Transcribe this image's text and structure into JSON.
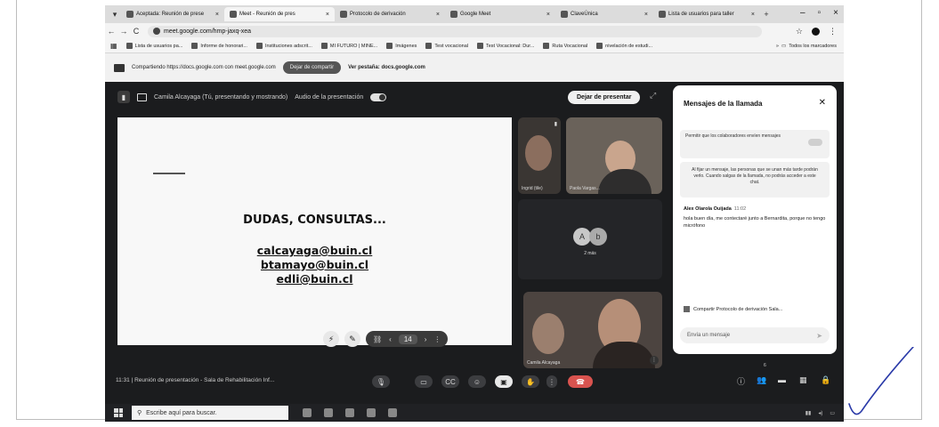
{
  "browser": {
    "tabs": [
      {
        "label": "Aceptada: Reunión de prese",
        "active": false
      },
      {
        "label": "Meet - Reunión de pres",
        "active": true
      },
      {
        "label": "Protocolo de derivación",
        "active": false
      },
      {
        "label": "Google Meet",
        "active": false
      },
      {
        "label": "ClaveÚnica",
        "active": false
      },
      {
        "label": "Lista de usuarios para taller",
        "active": false
      }
    ],
    "url": "meet.google.com/hmp-jaxq-xea",
    "bookmarks": [
      "Lista de usuarios pa...",
      "Informe de honorari...",
      "Instituciones adscrit...",
      "MI FUTURO | MINE...",
      "Imágenes",
      "Test vocacional",
      "Test Vocacional: Dur...",
      "Ruta Vocacional",
      "nivelación de estudi..."
    ],
    "all_bookmarks": "Todos los marcadores"
  },
  "share_bar": {
    "text": "Compartiendo https://docs.google.com con meet.google.com",
    "stop_label": "Dejar de compartir",
    "tab_text": "Ver pestaña: docs.google.com"
  },
  "meet": {
    "presenting_text": "Camila Alcayaga (Tú, presentando y mostrando)",
    "audio_text": "Audio de la presentación",
    "stop_presenting": "Dejar de presentar",
    "slide": {
      "title": "DUDAS, CONSULTAS...",
      "emails": [
        "calcayaga@buin.cl",
        "btamayo@buin.cl",
        "edli@buin.cl"
      ]
    },
    "slide_page": "14",
    "tiles": [
      {
        "name": "Ingrid (tile)"
      },
      {
        "name": "Paola Vargas..."
      },
      {
        "name": "2 más",
        "avatars": [
          "A",
          "b"
        ]
      },
      {
        "name": "Camila Alcayaga"
      }
    ],
    "meeting_info": "11:31  |  Reunión de presentación - Sala de Rehabilitación Inf...",
    "participant_count": "6"
  },
  "chat": {
    "title": "Mensajes de la llamada",
    "permission_text": "Permitir que los colaboradores envíen mensajes",
    "info_text": "Al fijar un mensaje, las personas que se unan más tarde podrán verlo. Cuando salgas de la llamada, no podrás acceder a este chat.",
    "messages": [
      {
        "sender": "Alex Olarola Ouijada",
        "time": "11:02",
        "text": "hola buen día, me contectaré junto a Bernardita, porque no tengo micrófono"
      }
    ],
    "pinned_link": "Compartir Protocolo de derivación Sala...",
    "input_placeholder": "Envía un mensaje"
  },
  "taskbar": {
    "search_placeholder": "Escribe aquí para buscar."
  },
  "colors": {
    "meet_bg": "#1b1c1e",
    "hangup": "#d9534f",
    "pen_ink": "#2a3aa8"
  }
}
